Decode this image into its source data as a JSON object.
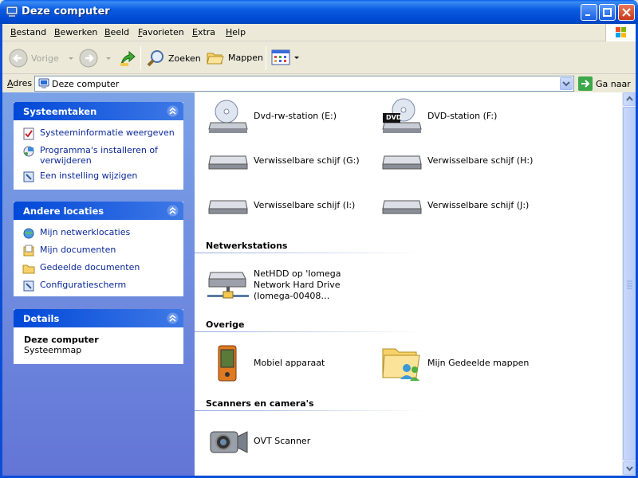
{
  "window": {
    "title": "Deze computer"
  },
  "menu": [
    {
      "u": "B",
      "rest": "estand"
    },
    {
      "u": "B",
      "rest": "ewerken"
    },
    {
      "u": "B",
      "rest": "eeld"
    },
    {
      "u": "F",
      "rest": "avorieten"
    },
    {
      "u": "E",
      "rest": "xtra"
    },
    {
      "u": "H",
      "rest": "elp"
    }
  ],
  "toolbar": {
    "back": "Vorige",
    "search": "Zoeken",
    "folders": "Mappen"
  },
  "address": {
    "label": "Adres",
    "value": "Deze computer",
    "go": "Ga naar"
  },
  "panels": {
    "systeemtaken": {
      "title": "Systeemtaken",
      "items": [
        "Systeeminformatie weergeven",
        "Programma's installeren of verwijderen",
        "Een instelling wijzigen"
      ]
    },
    "andere": {
      "title": "Andere locaties",
      "items": [
        "Mijn netwerklocaties",
        "Mijn documenten",
        "Gedeelde documenten",
        "Configuratiescherm"
      ]
    },
    "details": {
      "title": "Details",
      "name": "Deze computer",
      "type": "Systeemmap"
    }
  },
  "drives": [
    {
      "label": "Dvd-rw-station (E:)",
      "icon": "dvd-rw-drive-icon"
    },
    {
      "label": "DVD-station (F:)",
      "icon": "dvd-drive-icon",
      "badge": "DVD"
    },
    {
      "label": "Verwisselbare schijf (G:)",
      "icon": "removable-disk-icon"
    },
    {
      "label": "Verwisselbare schijf (H:)",
      "icon": "removable-disk-icon"
    },
    {
      "label": "Verwisselbare schijf (I:)",
      "icon": "removable-disk-icon"
    },
    {
      "label": "Verwisselbare schijf (J:)",
      "icon": "removable-disk-icon"
    }
  ],
  "groups": {
    "network": {
      "title": "Netwerkstations",
      "item": "NetHDD op 'Iomega Network Hard Drive (Iomega-00408…"
    },
    "other": {
      "title": "Overige",
      "items": [
        "Mobiel apparaat",
        "Mijn Gedeelde mappen"
      ]
    },
    "scanners": {
      "title": "Scanners en camera's",
      "item": "OVT Scanner"
    }
  },
  "colors": {
    "titlebar": "#0054e3",
    "taskpane": "#6f8fe0",
    "link": "#0a2896"
  }
}
